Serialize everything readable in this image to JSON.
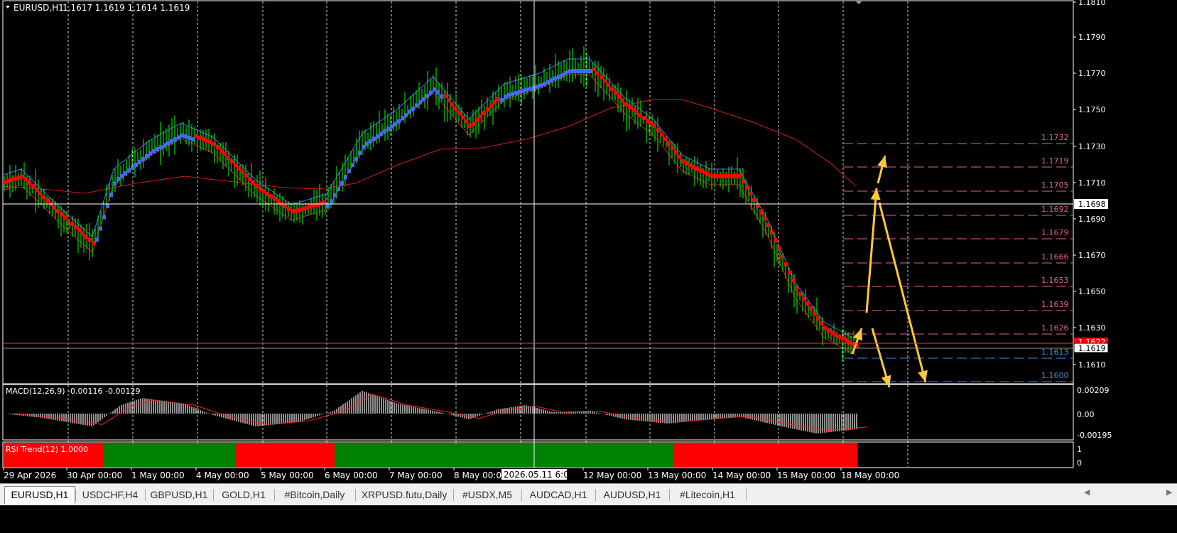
{
  "symbol_header": {
    "title": "EURUSD,H1",
    "ohlc": "1.1617 1.1619 1.1614 1.1619"
  },
  "price_axis": {
    "labels": [
      "1.1810",
      "1.1790",
      "1.1770",
      "1.1750",
      "1.1730",
      "1.1710",
      "1.1690",
      "1.1670",
      "1.1650",
      "1.1630",
      "1.1610"
    ],
    "current_price": "1.1619",
    "crosshair_price": "1.1698",
    "red_line_price": "1.1622"
  },
  "price_levels": [
    {
      "label": "1.1732",
      "color": "#e060a0"
    },
    {
      "label": "1.1719",
      "color": "#e060a0"
    },
    {
      "label": "1.1705",
      "color": "#e060a0"
    },
    {
      "label": "1.1692",
      "color": "#e060a0"
    },
    {
      "label": "1.1679",
      "color": "#e060a0"
    },
    {
      "label": "1.1666",
      "color": "#e060a0"
    },
    {
      "label": "1.1653",
      "color": "#e060a0"
    },
    {
      "label": "1.1639",
      "color": "#e060a0"
    },
    {
      "label": "1.1626",
      "color": "#e060a0"
    },
    {
      "label": "1.1613",
      "color": "#3a8fe0"
    },
    {
      "label": "1.1600",
      "color": "#3a8fe0"
    }
  ],
  "macd": {
    "title": "MACD(12,26,9) -0.00116 -0.00129",
    "axis": [
      "0.00209",
      "0.00",
      "-0.00195"
    ]
  },
  "rsi": {
    "title": "RSI Trend(12) 1.0000",
    "axis": [
      "1",
      "0"
    ],
    "segments": [
      {
        "state": "down",
        "color": "#ff0000"
      },
      {
        "state": "up",
        "color": "#008000"
      },
      {
        "state": "down",
        "color": "#ff0000"
      },
      {
        "state": "up",
        "color": "#008000"
      },
      {
        "state": "down",
        "color": "#ff0000"
      }
    ]
  },
  "time_axis": {
    "labels": [
      "29 Apr 2026",
      "30 Apr 00:00",
      "1 May 00:00",
      "4 May 00:00",
      "5 May 00:00",
      "6 May 00:00",
      "7 May 00:00",
      "8 May 00:00",
      "12 May 00:00",
      "13 May 00:00",
      "14 May 00:00",
      "15 May 00:00",
      "18 May 00:00"
    ],
    "crosshair_time": "2026.05.11 6:00"
  },
  "colors": {
    "bull_candle": "#00ff00",
    "ma_up": "#3d6cf0",
    "ma_down": "#ff0000",
    "arrow": "#ffc83a",
    "grid": "#ffffff"
  },
  "tabs": [
    "EURUSD,H1",
    "USDCHF,H4",
    "GBPUSD,H1",
    "GOLD,H1",
    "#Bitcoin,Daily",
    "XRPUSD.futu,Daily",
    "#USDX,M5",
    "AUDCAD,H1",
    "AUDUSD,H1",
    "#Litecoin,H1"
  ],
  "active_tab": "EURUSD,H1"
}
